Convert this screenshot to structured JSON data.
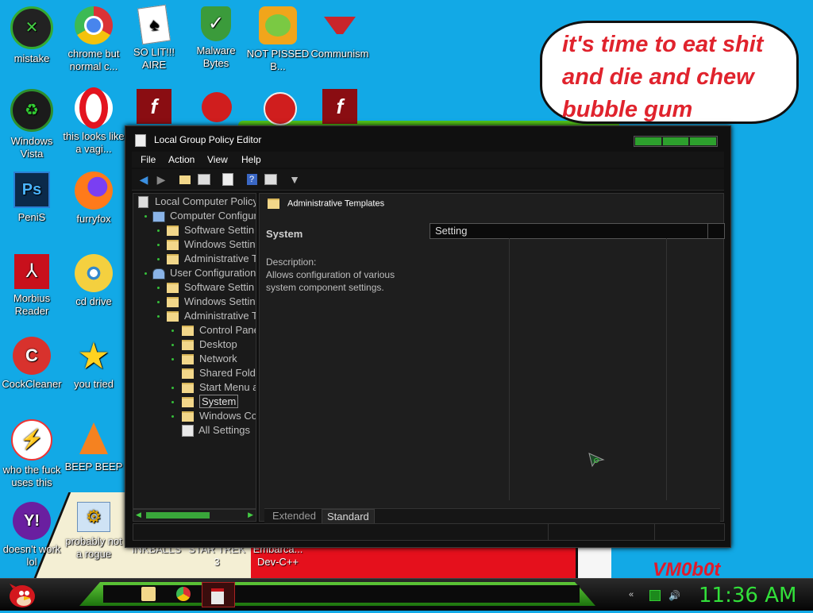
{
  "desktop": {
    "icons": [
      {
        "label": "mistake",
        "icon": "xbox-icon"
      },
      {
        "label": "chrome but normal c...",
        "icon": "chrome-icon"
      },
      {
        "label": "SO LIT!!! AIRE",
        "icon": "solitaire-icon"
      },
      {
        "label": "Malware Bytes",
        "icon": "shield-icon"
      },
      {
        "label": "NOT PISSED B...",
        "icon": "angry-pig-icon"
      },
      {
        "label": "Communism",
        "icon": "logo-icon"
      },
      {
        "label": "Windows Vista",
        "icon": "vista-icon"
      },
      {
        "label": "this looks like a vagi...",
        "icon": "opera-icon"
      },
      {
        "label": "PeniS",
        "icon": "photoshop-icon"
      },
      {
        "label": "furryfox",
        "icon": "firefox-icon"
      },
      {
        "label": "Morbius Reader",
        "icon": "pdf-icon"
      },
      {
        "label": "cd drive",
        "icon": "cd-icon"
      },
      {
        "label": "CockCleaner",
        "icon": "ccleaner-icon"
      },
      {
        "label": "you tried",
        "icon": "star-icon"
      },
      {
        "label": "who the fuck uses this",
        "icon": "lightning-icon"
      },
      {
        "label": "BEEP BEEP",
        "icon": "vlc-icon"
      },
      {
        "label": "doesn't work lol",
        "icon": "yahoo-icon"
      },
      {
        "label": "probably not a rogue",
        "icon": "gear-icon"
      }
    ],
    "partial_labels": [
      "INKBALLS",
      "STAR TREK 3",
      "Embarca... Dev-C++"
    ],
    "speech_bubble": "it's time to eat shit and die and chew bubble gum",
    "watermark": "VM0b0t"
  },
  "window": {
    "title": "Local Group Policy Editor",
    "menu": [
      "File",
      "Action",
      "View",
      "Help"
    ],
    "tree": [
      {
        "label": "Local Computer Policy",
        "level": 0
      },
      {
        "label": "Computer Configura",
        "level": 1
      },
      {
        "label": "Software Settin",
        "level": 2
      },
      {
        "label": "Windows Settin",
        "level": 2
      },
      {
        "label": "Administrative T",
        "level": 2
      },
      {
        "label": "User Configuration",
        "level": 1
      },
      {
        "label": "Software Settin",
        "level": 2
      },
      {
        "label": "Windows Settin",
        "level": 2
      },
      {
        "label": "Administrative T",
        "level": 2
      },
      {
        "label": "Control Pane",
        "level": 3
      },
      {
        "label": "Desktop",
        "level": 3
      },
      {
        "label": "Network",
        "level": 3
      },
      {
        "label": "Shared Fold",
        "level": 3
      },
      {
        "label": "Start Menu a",
        "level": 3
      },
      {
        "label": "System",
        "level": 3,
        "selected": true
      },
      {
        "label": "Windows Co",
        "level": 3
      },
      {
        "label": "All Settings",
        "level": 3
      }
    ],
    "breadcrumb": "Administrative Templates",
    "section_title": "System",
    "description_label": "Description:",
    "description_text": "Allows configuration of various system component settings.",
    "column_header": "Setting",
    "tabs": [
      "Extended",
      "Standard"
    ],
    "active_tab": "Standard"
  },
  "taskbar": {
    "clock": "11:36 AM"
  }
}
